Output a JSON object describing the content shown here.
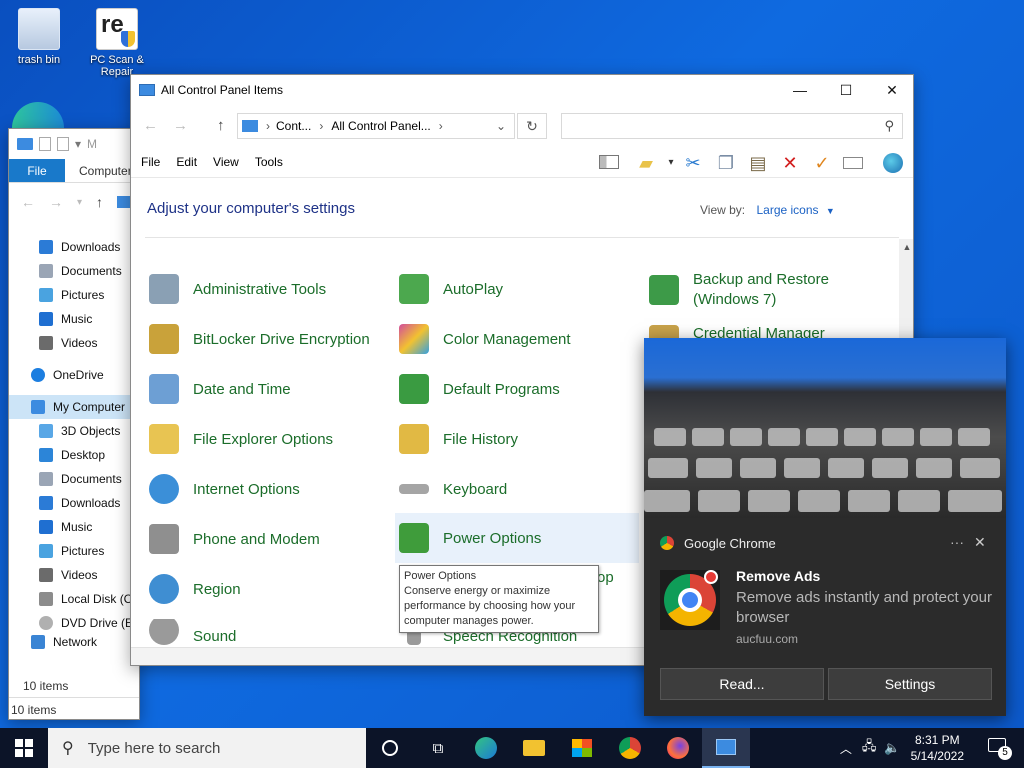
{
  "desktop": {
    "icons": [
      {
        "label": "trash bin",
        "icon": "recycle-bin-icon"
      },
      {
        "label": "PC Scan & Repair",
        "icon": "pc-scan-repair-icon"
      }
    ]
  },
  "explorer": {
    "title_partial": "M",
    "ribbon": {
      "file": "File",
      "computer": "Computer"
    },
    "tree": [
      {
        "label": "Downloads",
        "color": "#2b7bd6"
      },
      {
        "label": "Documents",
        "color": "#9aa5b5"
      },
      {
        "label": "Pictures",
        "color": "#4aa3e0"
      },
      {
        "label": "Music",
        "color": "#1f6fd1"
      },
      {
        "label": "Videos",
        "color": "#6b6b6b"
      },
      {
        "label": "OneDrive",
        "color": "#1c7ee0"
      },
      {
        "label": "My Computer",
        "color": "#3c8be0"
      },
      {
        "label": "3D Objects",
        "color": "#59a7e6"
      },
      {
        "label": "Desktop",
        "color": "#2c85d8"
      },
      {
        "label": "Documents",
        "color": "#9aa5b5"
      },
      {
        "label": "Downloads",
        "color": "#2b7bd6"
      },
      {
        "label": "Music",
        "color": "#1f6fd1"
      },
      {
        "label": "Pictures",
        "color": "#4aa3e0"
      },
      {
        "label": "Videos",
        "color": "#6b6b6b"
      },
      {
        "label": "Local Disk (C",
        "color": "#8c8c8c"
      },
      {
        "label": "DVD Drive (E",
        "color": "#b0b0b0"
      },
      {
        "label": "Network",
        "color": "#3a84d4"
      }
    ],
    "status_inner": "10 items",
    "status_outer": "10 items"
  },
  "control_panel": {
    "title": "All Control Panel Items",
    "address": {
      "crumb1": "Cont...",
      "sep": "›",
      "crumb2": "All Control Panel..."
    },
    "menu": [
      "File",
      "Edit",
      "View",
      "Tools"
    ],
    "heading": "Adjust your computer's settings",
    "view_by_label": "View by:",
    "view_by_value": "Large icons",
    "items": [
      {
        "label": "Administrative Tools",
        "color": "#8aa0b4"
      },
      {
        "label": "BitLocker Drive Encryption",
        "color": "#c9a23a"
      },
      {
        "label": "Date and Time",
        "color": "#6d9fd4"
      },
      {
        "label": "File Explorer Options",
        "color": "#e8c452"
      },
      {
        "label": "Internet Options",
        "color": "#3b8fd8"
      },
      {
        "label": "Phone and Modem",
        "color": "#8f8f8f"
      },
      {
        "label": "Region",
        "color": "#3f8ed2"
      },
      {
        "label": "Sound",
        "color": "#9a9a9a"
      },
      {
        "label": "AutoPlay",
        "color": "#4ca84e"
      },
      {
        "label": "Color Management",
        "color": "#d24d9c"
      },
      {
        "label": "Default Programs",
        "color": "#3a9b41"
      },
      {
        "label": "File History",
        "color": "#e1b944"
      },
      {
        "label": "Keyboard",
        "color": "#a5a5a5"
      },
      {
        "label": "Power Options",
        "color": "#3f9c3b"
      },
      {
        "label": "Speech Recognition",
        "color": "#9a9a9a"
      },
      {
        "label": "Backup and Restore",
        "label2": "(Windows 7)",
        "color": "#3d9a48"
      },
      {
        "label": "Credential Manager",
        "color": "#c8a24a"
      }
    ],
    "partial_text": "op",
    "tooltip": {
      "title": "Power Options",
      "body": "Conserve energy or maximize performance by choosing how your computer manages power."
    }
  },
  "toast": {
    "app": "Google Chrome",
    "more": "···",
    "close": "✕",
    "title": "Remove Ads",
    "body": "Remove ads instantly and protect your browser",
    "source": "aucfuu.com",
    "btn_read": "Read...",
    "btn_settings": "Settings"
  },
  "taskbar": {
    "search_placeholder": "Type here to search",
    "time": "8:31 PM",
    "date": "5/14/2022",
    "notifications": "5"
  }
}
